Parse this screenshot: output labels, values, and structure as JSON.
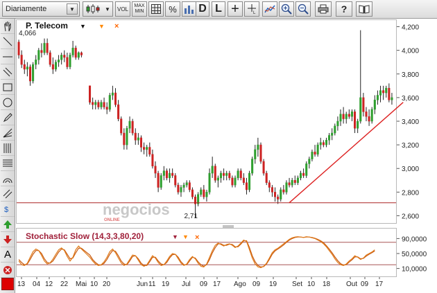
{
  "toolbar": {
    "period": "Diariamente",
    "vol_label": "VOL",
    "maxmin_top": "MAX",
    "maxmin_bottom": "MIN",
    "percent_label": "%",
    "d_label": "D",
    "l_label": "L",
    "plus_label": "+",
    "help_label": "?"
  },
  "chart": {
    "instrument": "P. Telecom",
    "last_close": "4,066",
    "low_annotation": "2,71",
    "watermark": "negocios",
    "watermark_sub": "ONLINE",
    "price_ticks": [
      "4,200",
      "4,000",
      "3,800",
      "3,600",
      "3,400",
      "3,200",
      "3,000",
      "2,800",
      "2,600"
    ],
    "oscillator_title": "Stochastic Slow (14,3,3,80,20)",
    "oscillator_ticks": [
      "90,0000",
      "50,0000",
      "10,0000"
    ],
    "date_ticks": [
      "13",
      "04",
      "12",
      "22",
      "Mai",
      "10",
      "20",
      "Jun",
      "11",
      "19",
      "Jul",
      "09",
      "17",
      "Ago",
      "09",
      "19",
      "Set",
      "10",
      "18",
      "Out",
      "09",
      "17"
    ]
  },
  "colors": {
    "up": "#2e9e2e",
    "down": "#cc2222",
    "trendline": "#dd2222",
    "support": "#aa2222",
    "stoch_k": "#e07b1a",
    "stoch_d": "#c85a10"
  },
  "chart_data": {
    "type": "candlestick",
    "price_axis": {
      "min": 2.55,
      "max": 4.25,
      "ticks": [
        4.2,
        4.0,
        3.8,
        3.6,
        3.4,
        3.2,
        3.0,
        2.8,
        2.6
      ]
    },
    "support_level": 2.71,
    "trendline": {
      "from_index": 93,
      "from_value": 2.71,
      "to_index": 132,
      "to_value": 3.56
    },
    "candles": [
      [
        4.07,
        4.09,
        3.93,
        3.96
      ],
      [
        3.96,
        4.0,
        3.85,
        3.88
      ],
      [
        3.88,
        3.92,
        3.8,
        3.84
      ],
      [
        3.84,
        3.9,
        3.78,
        3.86
      ],
      [
        3.86,
        3.88,
        3.7,
        3.74
      ],
      [
        3.74,
        3.9,
        3.72,
        3.88
      ],
      [
        3.88,
        3.96,
        3.84,
        3.92
      ],
      [
        3.92,
        4.02,
        3.88,
        4.0
      ],
      [
        4.0,
        4.06,
        3.94,
        3.98
      ],
      [
        3.98,
        4.1,
        3.96,
        4.06
      ],
      [
        4.06,
        4.1,
        3.96,
        3.98
      ],
      [
        3.98,
        4.0,
        3.86,
        3.88
      ],
      [
        3.88,
        3.94,
        3.8,
        3.84
      ],
      [
        3.84,
        3.92,
        3.82,
        3.9
      ],
      [
        3.9,
        3.96,
        3.86,
        3.92
      ],
      [
        3.92,
        3.98,
        3.88,
        3.96
      ],
      [
        3.96,
        4.0,
        3.9,
        3.94
      ],
      [
        3.94,
        3.98,
        3.84,
        3.86
      ],
      [
        3.86,
        3.98,
        3.84,
        3.96
      ],
      [
        3.96,
        4.08,
        3.94,
        4.02
      ],
      [
        4.02,
        4.04,
        3.92,
        3.94
      ],
      [
        3.94,
        3.99,
        3.92,
        3.98
      ],
      [
        3.98,
        3.99,
        3.94,
        3.96
      ],
      [
        3.7,
        3.7,
        3.54,
        3.56
      ],
      [
        3.56,
        3.6,
        3.5,
        3.54
      ],
      [
        3.54,
        3.58,
        3.5,
        3.56
      ],
      [
        3.56,
        3.58,
        3.5,
        3.52
      ],
      [
        3.52,
        3.58,
        3.5,
        3.56
      ],
      [
        3.56,
        3.6,
        3.5,
        3.52
      ],
      [
        3.52,
        3.56,
        3.46,
        3.5
      ],
      [
        3.5,
        3.64,
        3.48,
        3.62
      ],
      [
        3.62,
        3.7,
        3.58,
        3.64
      ],
      [
        3.64,
        3.68,
        3.52,
        3.54
      ],
      [
        3.54,
        3.58,
        3.4,
        3.42
      ],
      [
        3.42,
        3.44,
        3.28,
        3.3
      ],
      [
        3.3,
        3.34,
        3.16,
        3.2
      ],
      [
        3.2,
        3.36,
        3.16,
        3.34
      ],
      [
        3.34,
        3.44,
        3.3,
        3.4
      ],
      [
        3.4,
        3.42,
        3.28,
        3.3
      ],
      [
        3.3,
        3.34,
        3.2,
        3.24
      ],
      [
        3.24,
        3.3,
        3.2,
        3.26
      ],
      [
        3.26,
        3.28,
        3.14,
        3.18
      ],
      [
        3.18,
        3.22,
        3.12,
        3.16
      ],
      [
        3.16,
        3.2,
        3.1,
        3.18
      ],
      [
        3.18,
        3.22,
        3.1,
        3.12
      ],
      [
        3.12,
        3.16,
        3.0,
        3.02
      ],
      [
        3.02,
        3.06,
        2.92,
        2.96
      ],
      [
        2.96,
        2.98,
        2.8,
        2.84
      ],
      [
        2.84,
        2.96,
        2.82,
        2.94
      ],
      [
        2.94,
        3.02,
        2.9,
        2.98
      ],
      [
        2.98,
        3.0,
        2.9,
        2.92
      ],
      [
        2.92,
        3.0,
        2.88,
        2.96
      ],
      [
        2.96,
        3.0,
        2.92,
        2.94
      ],
      [
        2.94,
        2.96,
        2.84,
        2.86
      ],
      [
        2.86,
        2.88,
        2.78,
        2.8
      ],
      [
        2.8,
        2.86,
        2.76,
        2.84
      ],
      [
        2.84,
        2.88,
        2.8,
        2.86
      ],
      [
        2.86,
        2.9,
        2.84,
        2.88
      ],
      [
        2.88,
        2.9,
        2.8,
        2.82
      ],
      [
        2.82,
        2.84,
        2.74,
        2.76
      ],
      [
        2.76,
        2.78,
        2.58,
        2.7
      ],
      [
        2.7,
        2.8,
        2.68,
        2.78
      ],
      [
        2.78,
        2.84,
        2.76,
        2.82
      ],
      [
        2.82,
        2.86,
        2.74,
        2.76
      ],
      [
        2.76,
        2.82,
        2.72,
        2.8
      ],
      [
        2.8,
        3.0,
        2.78,
        2.96
      ],
      [
        2.96,
        3.1,
        2.92,
        3.02
      ],
      [
        3.02,
        3.04,
        2.88,
        2.9
      ],
      [
        2.9,
        2.94,
        2.84,
        2.92
      ],
      [
        2.92,
        2.98,
        2.88,
        2.96
      ],
      [
        2.96,
        3.0,
        2.9,
        2.94
      ],
      [
        2.94,
        2.98,
        2.9,
        2.96
      ],
      [
        2.96,
        2.98,
        2.9,
        2.92
      ],
      [
        2.92,
        2.94,
        2.84,
        2.86
      ],
      [
        2.86,
        2.94,
        2.84,
        2.92
      ],
      [
        2.92,
        3.0,
        2.9,
        2.98
      ],
      [
        2.98,
        3.0,
        2.9,
        2.92
      ],
      [
        2.92,
        2.96,
        2.86,
        2.88
      ],
      [
        2.88,
        2.92,
        2.78,
        2.82
      ],
      [
        2.82,
        2.98,
        2.8,
        2.96
      ],
      [
        2.96,
        3.1,
        2.94,
        3.08
      ],
      [
        3.08,
        3.2,
        3.04,
        3.16
      ],
      [
        3.16,
        3.26,
        3.1,
        3.2
      ],
      [
        3.2,
        3.22,
        3.04,
        3.06
      ],
      [
        3.06,
        3.08,
        2.94,
        2.96
      ],
      [
        2.96,
        2.98,
        2.86,
        2.88
      ],
      [
        2.88,
        2.9,
        2.8,
        2.84
      ],
      [
        2.84,
        2.86,
        2.76,
        2.8
      ],
      [
        2.8,
        2.84,
        2.72,
        2.76
      ],
      [
        2.76,
        2.78,
        2.7,
        2.74
      ],
      [
        2.74,
        2.84,
        2.72,
        2.82
      ],
      [
        2.82,
        2.86,
        2.78,
        2.8
      ],
      [
        2.8,
        2.9,
        2.78,
        2.88
      ],
      [
        2.88,
        2.92,
        2.84,
        2.86
      ],
      [
        2.86,
        2.92,
        2.84,
        2.9
      ],
      [
        2.9,
        2.94,
        2.86,
        2.88
      ],
      [
        2.88,
        2.94,
        2.86,
        2.92
      ],
      [
        2.92,
        2.98,
        2.9,
        2.96
      ],
      [
        2.96,
        3.0,
        2.92,
        2.94
      ],
      [
        2.94,
        3.06,
        2.92,
        3.04
      ],
      [
        3.04,
        3.1,
        3.0,
        3.08
      ],
      [
        3.08,
        3.16,
        3.06,
        3.14
      ],
      [
        3.14,
        3.2,
        3.1,
        3.12
      ],
      [
        3.12,
        3.22,
        3.1,
        3.2
      ],
      [
        3.2,
        3.26,
        3.16,
        3.22
      ],
      [
        3.22,
        3.24,
        3.18,
        3.2
      ],
      [
        3.2,
        3.26,
        3.18,
        3.24
      ],
      [
        3.24,
        3.3,
        3.2,
        3.28
      ],
      [
        3.28,
        3.34,
        3.24,
        3.3
      ],
      [
        3.3,
        3.38,
        3.28,
        3.36
      ],
      [
        3.36,
        3.44,
        3.32,
        3.4
      ],
      [
        3.4,
        3.5,
        3.36,
        3.46
      ],
      [
        3.46,
        3.52,
        3.38,
        3.42
      ],
      [
        3.42,
        3.48,
        3.38,
        3.46
      ],
      [
        3.46,
        3.5,
        3.42,
        3.44
      ],
      [
        3.44,
        3.5,
        3.4,
        3.48
      ],
      [
        3.48,
        3.5,
        3.3,
        3.34
      ],
      [
        3.34,
        3.42,
        3.3,
        3.4
      ],
      [
        3.4,
        4.17,
        3.38,
        3.6
      ],
      [
        3.6,
        3.64,
        3.44,
        3.48
      ],
      [
        3.48,
        3.52,
        3.4,
        3.44
      ],
      [
        3.44,
        3.5,
        3.36,
        3.4
      ],
      [
        3.4,
        3.52,
        3.38,
        3.5
      ],
      [
        3.5,
        3.62,
        3.46,
        3.58
      ],
      [
        3.58,
        3.66,
        3.54,
        3.62
      ],
      [
        3.62,
        3.7,
        3.56,
        3.66
      ],
      [
        3.66,
        3.7,
        3.58,
        3.64
      ],
      [
        3.64,
        3.7,
        3.6,
        3.68
      ],
      [
        3.68,
        3.72,
        3.56,
        3.58
      ],
      [
        3.58,
        3.64,
        3.54,
        3.6
      ]
    ],
    "gaps": [
      [
        22,
        23
      ]
    ],
    "stoch_axis": {
      "min": 0,
      "max": 100,
      "ticks": [
        90,
        50,
        10
      ],
      "bands": [
        80,
        20
      ]
    },
    "stoch_k": [
      30,
      20,
      18,
      24,
      40,
      55,
      62,
      58,
      45,
      30,
      22,
      25,
      35,
      48,
      60,
      65,
      58,
      42,
      30,
      40,
      60,
      70,
      62,
      40,
      30,
      22,
      18,
      20,
      28,
      40,
      55,
      62,
      52,
      38,
      25,
      18,
      22,
      34,
      46,
      44,
      32,
      20,
      16,
      20,
      32,
      44,
      38,
      26,
      18,
      20,
      30,
      42,
      50,
      48,
      36,
      24,
      18,
      22,
      34,
      42,
      36,
      24,
      16,
      14,
      22,
      40,
      58,
      72,
      78,
      74,
      70,
      74,
      76,
      72,
      66,
      70,
      78,
      86,
      82,
      60,
      38,
      22,
      14,
      12,
      16,
      24,
      38,
      52,
      60,
      64,
      70,
      76,
      82,
      88,
      92,
      94,
      95,
      94,
      93,
      95,
      94,
      92,
      90,
      86,
      82,
      76,
      68,
      58,
      48,
      36,
      26,
      20,
      18,
      22,
      30,
      36,
      44,
      40,
      34,
      38,
      46,
      50,
      54,
      60
    ],
    "stoch_d": [
      34,
      26,
      20,
      22,
      34,
      48,
      58,
      58,
      50,
      36,
      26,
      24,
      30,
      42,
      54,
      62,
      60,
      48,
      36,
      38,
      52,
      64,
      64,
      46,
      34,
      26,
      20,
      19,
      24,
      34,
      48,
      58,
      56,
      44,
      30,
      22,
      20,
      30,
      42,
      44,
      36,
      24,
      18,
      18,
      28,
      40,
      40,
      30,
      22,
      20,
      26,
      38,
      47,
      48,
      40,
      28,
      20,
      20,
      30,
      40,
      38,
      28,
      20,
      16,
      20,
      34,
      52,
      66,
      76,
      76,
      72,
      72,
      75,
      74,
      68,
      68,
      75,
      84,
      84,
      66,
      44,
      28,
      18,
      14,
      15,
      22,
      34,
      48,
      57,
      62,
      67,
      73,
      80,
      86,
      90,
      93,
      94,
      94,
      93,
      94,
      94,
      93,
      91,
      88,
      84,
      79,
      71,
      62,
      52,
      41,
      31,
      23,
      19,
      20,
      27,
      33,
      41,
      41,
      36,
      37,
      43,
      48,
      52,
      57
    ]
  }
}
